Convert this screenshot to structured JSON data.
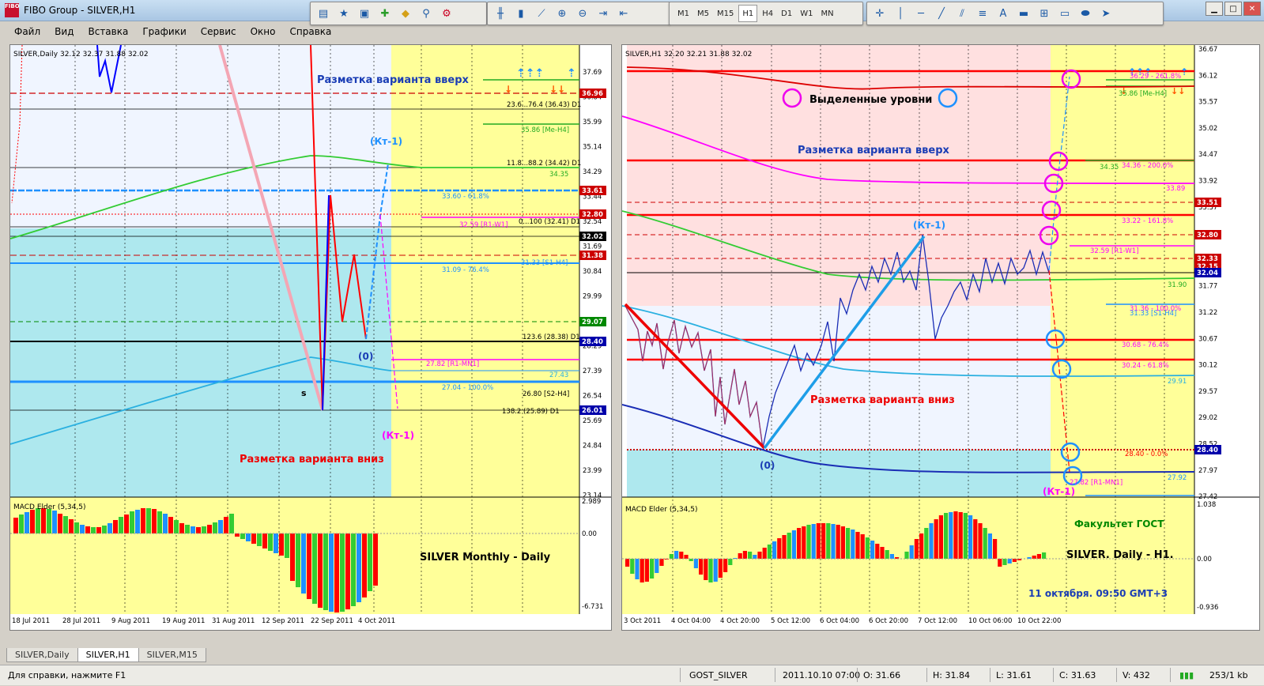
{
  "app": {
    "title": "FIBO Group - SILVER,H1",
    "logo": "FIBO"
  },
  "toolbar": {
    "timeframes": [
      "M1",
      "M5",
      "M15",
      "H1",
      "H4",
      "D1",
      "W1",
      "MN"
    ],
    "active_timeframe": "H1",
    "tools_text": {
      "trendline_a": "A"
    }
  },
  "menu": {
    "items": [
      "Файл",
      "Вид",
      "Вставка",
      "Графики",
      "Сервис",
      "Окно",
      "Справка"
    ]
  },
  "left": {
    "header": "SILVER,Daily  32.12 32.37 31.88 32.02",
    "macd_label": "MACD Elder (5,34,5)",
    "price_ticks": [
      "37.69",
      "36.84",
      "35.99",
      "35.14",
      "34.29",
      "33.44",
      "32.54",
      "31.69",
      "30.84",
      "29.99",
      "29.14",
      "28.29",
      "27.39",
      "26.54",
      "25.69",
      "24.84",
      "23.99",
      "23.14"
    ],
    "macd_ticks": [
      "2.989",
      "0.00",
      "-6.731"
    ],
    "date_ticks": [
      "18 Jul 2011",
      "28 Jul 2011",
      "9 Aug 2011",
      "19 Aug 2011",
      "31 Aug 2011",
      "12 Sep 2011",
      "22 Sep 2011",
      "4 Oct 2011"
    ],
    "badges": {
      "b1": "36.96",
      "b2": "33.61",
      "b3": "32.80",
      "b4": "32.02",
      "b5": "31.38",
      "b6": "29.07",
      "b7": "28.40",
      "b8": "26.01"
    },
    "levels": {
      "l1": "23.6...76.4 (36.43) D1",
      "l2": "35.86 [Me-H4]",
      "l3": "11.8...88.2 (34.42) D1",
      "l4": "34.35",
      "l5": "33.60 - 61.8%",
      "l6": "0...100 (32.41) D1",
      "l7": "32.59 [R1-W1]",
      "l8": "31.33 [S1-H4]",
      "l9": "31.09 - 76.4%",
      "l10": "123.6 (28.38) D1",
      "l11": "27.82 [R1-MN1]",
      "l12": "27.43",
      "l13": "27.04 - 100.0%",
      "l14": "26.80 [S2-H4]",
      "l15": "138.2 (25.89) D1"
    },
    "texts": {
      "up": "Разметка варианта вверх",
      "down": "Разметка варианта вниз",
      "kt1": "(Кт-1)",
      "zero": "(0)",
      "kt1b": "(Кт-1)",
      "s": "s",
      "caption": "SILVER  Monthly - Daily"
    }
  },
  "right": {
    "header": "SILVER,H1  32.20 32.21 31.88 32.02",
    "macd_label": "MACD Elder (5,34,5)",
    "price_ticks": [
      "36.67",
      "36.12",
      "35.57",
      "35.02",
      "34.47",
      "33.92",
      "33.37",
      "32.82",
      "32.27",
      "31.77",
      "31.22",
      "30.67",
      "30.12",
      "29.57",
      "29.02",
      "28.52",
      "27.97",
      "27.42"
    ],
    "macd_ticks": [
      "1.038",
      "0.00",
      "-0.936"
    ],
    "date_ticks": [
      "3 Oct 2011",
      "4 Oct 04:00",
      "4 Oct 20:00",
      "5 Oct 12:00",
      "6 Oct 04:00",
      "6 Oct 20:00",
      "7 Oct 12:00",
      "10 Oct 06:00",
      "10 Oct 22:00"
    ],
    "badges": {
      "b1": "33.51",
      "b2": "32.80",
      "b3": "32.33",
      "b4": "32.15",
      "b5": "32.04",
      "b6": "28.40"
    },
    "levels": {
      "l1": "36.29 - 261.8%",
      "l2": "35.86 [Me-H4]",
      "l3": "34.35",
      "l4": "34.36 - 200.0%",
      "l5": "33.89",
      "l6": "33.22 - 161.8%",
      "l7": "32.59 [R1-W1]",
      "l8": "31.90",
      "l9": "31.36 - 100.0%",
      "l10": "31.33 [S1-H4]",
      "l11": "30.68 - 76.4%",
      "l12": "30.24 - 61.8%",
      "l13": "29.91",
      "l14": "28.40 - 0.0%",
      "l15": "27.92",
      "l16": "27.82 [R1-MN1]"
    },
    "texts": {
      "selected": "Выделенные уровни",
      "up": "Разметка варианта вверх",
      "kt1": "(Кт-1)",
      "down": "Разметка варианта вниз",
      "zero": "(0)",
      "kt1b": "(Кт-1)",
      "faculty": "Факультет ГОСТ",
      "caption": "SILVER. Daily - H1.",
      "date": "11 октября. 09:50 GMT+3"
    }
  },
  "tabs": [
    "SILVER,Daily",
    "SILVER,H1",
    "SILVER,M15"
  ],
  "active_tab": "SILVER,H1",
  "status": {
    "help": "Для справки, нажмите F1",
    "profile": "GOST_SILVER",
    "time": "2011.10.10 07:00",
    "open": "O: 31.66",
    "high": "H: 31.84",
    "low": "L: 31.61",
    "close": "C: 31.63",
    "volume": "V: 432",
    "traffic": "253/1 kb"
  },
  "colors": {
    "accent_red": "#ff0000",
    "fib_blue": "#1e90ff",
    "chart_yellow": "#ffff99",
    "chart_cyan": "#aee8ee",
    "chart_pink": "#ffe0e0"
  }
}
